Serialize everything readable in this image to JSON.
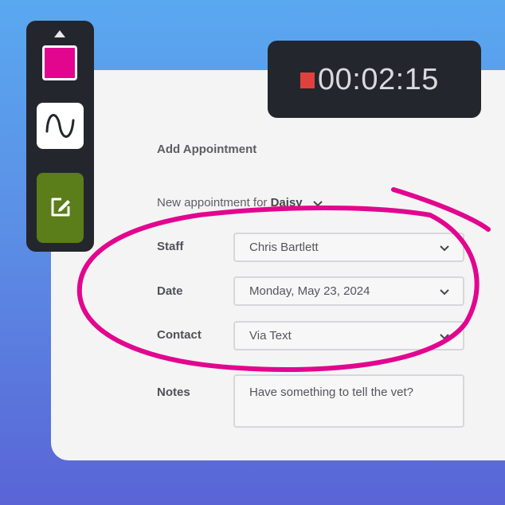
{
  "timer": {
    "display": "00:02:15"
  },
  "form": {
    "title": "Add Appointment",
    "subtitle_prefix": "New appointment for",
    "patient": "Daisy",
    "staff_label": "Staff",
    "staff_value": "Chris Bartlett",
    "date_label": "Date",
    "date_value": "Monday, May 23, 2024",
    "contact_label": "Contact",
    "contact_value": "Via Text",
    "notes_label": "Notes",
    "notes_placeholder": "Have something to tell the vet?"
  },
  "toolbar": {
    "selected_color": "#e2068f",
    "tools": [
      "color-swatch-icon",
      "freehand-curve-icon",
      "edit-note-icon"
    ]
  },
  "colors": {
    "annotation": "#e2068f",
    "recording": "#e0413e",
    "active_tool": "#5b7d1a"
  }
}
